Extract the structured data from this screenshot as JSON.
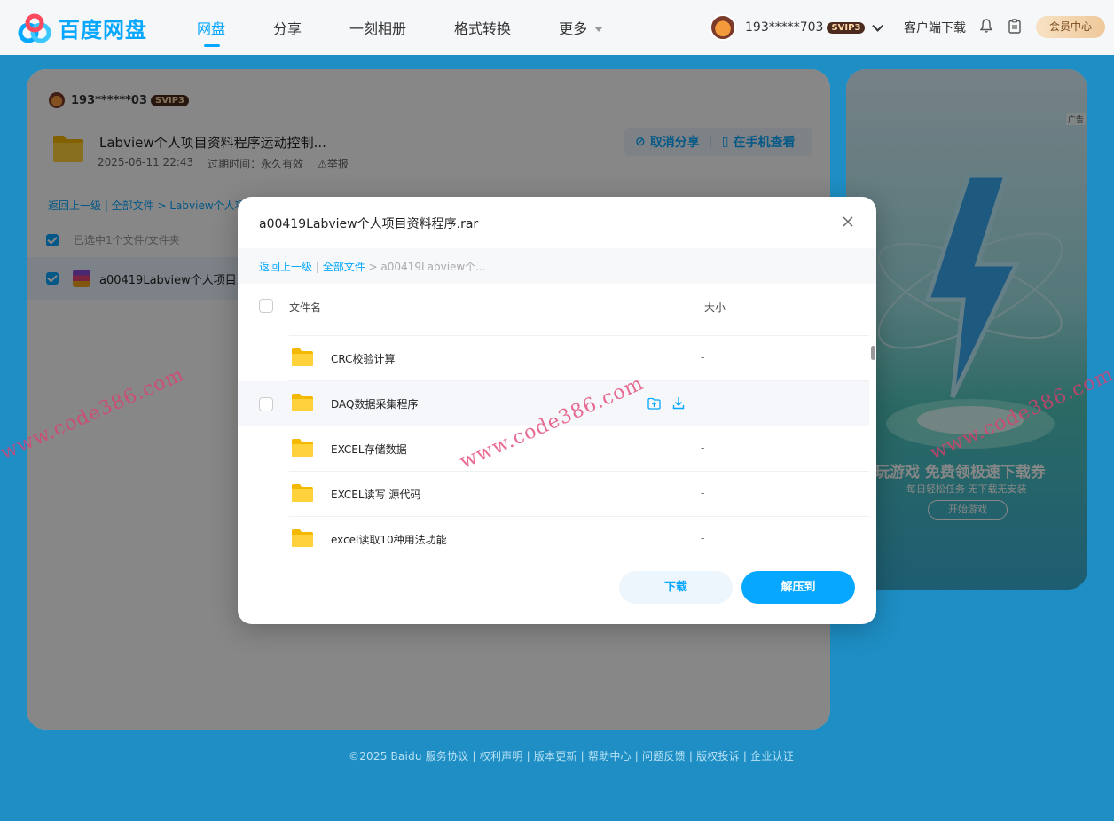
{
  "app": {
    "name": "百度网盘"
  },
  "nav": {
    "items": [
      "网盘",
      "分享",
      "一刻相册",
      "格式转换"
    ],
    "more": "更多"
  },
  "user": {
    "name": "193*****703",
    "vip": "SVIP3"
  },
  "header": {
    "client": "客户端下载",
    "vip_center": "会员中心"
  },
  "share": {
    "sharer": "193******03",
    "sharer_vip": "SVIP3",
    "title": "Labview个人项目资料程序运动控制...",
    "date": "2025-06-11 22:43",
    "expire": "过期时间：永久有效",
    "report": "举报",
    "cancel": "取消分享",
    "mobile": "在手机查看",
    "breadcrumb": "返回上一级 | 全部文件 > Labview个人项",
    "selected": "已选中1个文件/文件夹",
    "file": "a00419Labview个人项目资料"
  },
  "ad": {
    "tag": "广告",
    "title": "玩游戏 免费领极速下载券",
    "subtitle": "每日轻松任务 无下载无安装",
    "button": "开始游戏"
  },
  "footer": "©2025 Baidu  服务协议 | 权利声明 | 版本更新 | 帮助中心 | 问题反馈 | 版权投诉 | 企业认证",
  "modal": {
    "title": "a00419Labview个人项目资料程序.rar",
    "crumb_back": "返回上一级",
    "crumb_all": "全部文件",
    "crumb_current": "a00419Labview个...",
    "col_name": "文件名",
    "col_size": "大小",
    "rows": [
      {
        "name": "CRC校验计算",
        "size": "-"
      },
      {
        "name": "DAQ数据采集程序",
        "size": ""
      },
      {
        "name": "EXCEL存储数据",
        "size": "-"
      },
      {
        "name": "EXCEL读写 源代码",
        "size": "-"
      },
      {
        "name": "excel读取10种用法功能",
        "size": "-"
      }
    ],
    "download": "下载",
    "extract": "解压到"
  },
  "watermark": "www.code386.com",
  "colors": {
    "accent": "#06a7ff",
    "background": "#1e8ec4"
  }
}
